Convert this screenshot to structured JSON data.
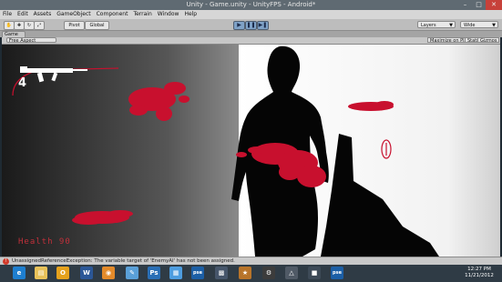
{
  "window": {
    "title": "Unity - Game.unity - UnityFPS - Android*",
    "controls": [
      "minimize-icon",
      "maximize-icon",
      "close-icon"
    ]
  },
  "menu": [
    "File",
    "Edit",
    "Assets",
    "GameObject",
    "Component",
    "Terrain",
    "Window",
    "Help"
  ],
  "toolbar": {
    "pivot_label": "Pivot",
    "global_label": "Global",
    "layers_label": "Layers",
    "layout_label": "Wide"
  },
  "game_tab": {
    "label": "Game",
    "aspect": "Free Aspect",
    "maximize": "Maximize on Play",
    "stats": "Stats",
    "gizmos": "Gizmos"
  },
  "hud": {
    "ammo": "4",
    "health_label": "Health 90",
    "accent_color": "#c8102e"
  },
  "status": {
    "message": "UnassignedReferenceException: The variable target of 'EnemyAI' has not been assigned."
  },
  "taskbar": {
    "pinned": [
      "ie-icon",
      "explorer-icon",
      "outlook-icon",
      "word-icon",
      "blender-icon",
      "paint-icon",
      "photoshop-icon",
      "store-icon",
      "photoshop-icon",
      "screenshot-icon",
      "game-icon",
      "steam-icon",
      "unity-icon",
      "monodevelop-icon",
      "photoshop-icon"
    ],
    "time": "12:27 PM",
    "date": "11/21/2012"
  }
}
